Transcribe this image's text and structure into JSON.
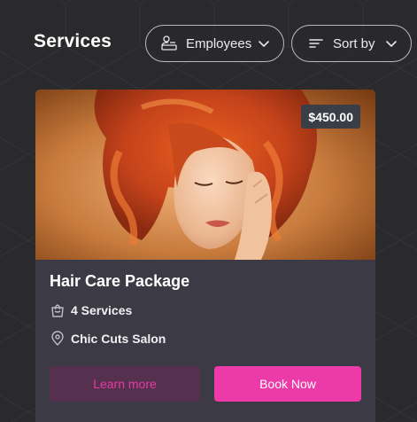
{
  "header": {
    "title": "Services",
    "employees_filter": {
      "label": "Employees",
      "icon": "employees-icon"
    },
    "sort_filter": {
      "label": "Sort by",
      "icon": "sort-lines-icon"
    }
  },
  "service_card": {
    "price": "$450.00",
    "title": "Hair Care Package",
    "services_count": "4 Services",
    "location": "Chic Cuts Salon",
    "learn_more_label": "Learn more",
    "book_now_label": "Book Now",
    "image": "woman-with-curly-red-hair-photo"
  },
  "colors": {
    "background": "#2a2a2d",
    "card": "#3c3b45",
    "accent_pink": "#ec3aa8",
    "learn_more_bg": "#56304f"
  }
}
